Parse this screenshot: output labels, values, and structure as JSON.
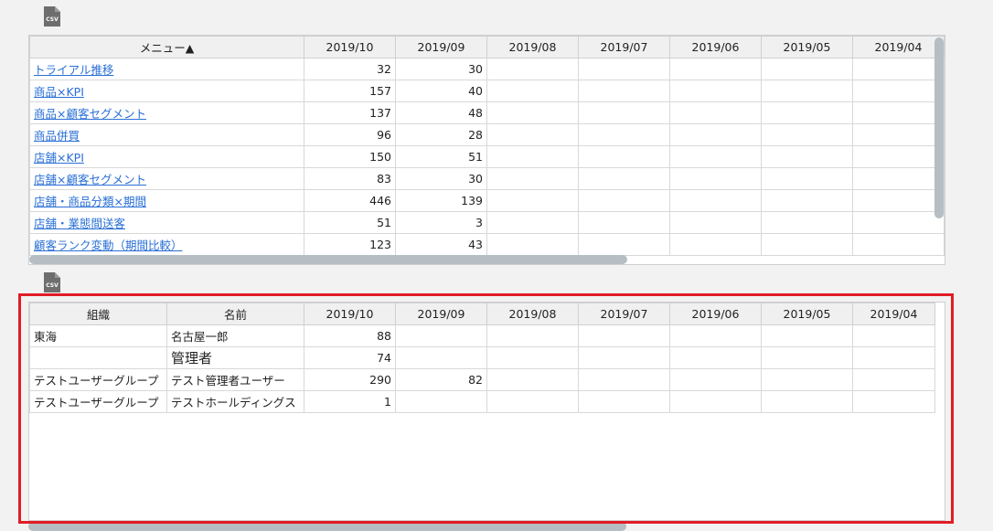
{
  "csv_icon_label": "CSV",
  "menu_table": {
    "columns": [
      "メニュー▲",
      "2019/10",
      "2019/09",
      "2019/08",
      "2019/07",
      "2019/06",
      "2019/05",
      "2019/04"
    ],
    "rows": [
      {
        "name": "トライアル推移",
        "v1": "32",
        "v2": "30"
      },
      {
        "name": "商品×KPI",
        "v1": "157",
        "v2": "40"
      },
      {
        "name": "商品×顧客セグメント",
        "v1": "137",
        "v2": "48"
      },
      {
        "name": "商品併買",
        "v1": "96",
        "v2": "28"
      },
      {
        "name": "店舗×KPI",
        "v1": "150",
        "v2": "51"
      },
      {
        "name": "店舗×顧客セグメント",
        "v1": "83",
        "v2": "30"
      },
      {
        "name": "店舗・商品分類×期間",
        "v1": "446",
        "v2": "139"
      },
      {
        "name": "店舗・業態間送客",
        "v1": "51",
        "v2": "3"
      },
      {
        "name": "顧客ランク変動（期間比較）",
        "v1": "123",
        "v2": "43"
      }
    ]
  },
  "user_table": {
    "columns": [
      "組織",
      "名前",
      "2019/10",
      "2019/09",
      "2019/08",
      "2019/07",
      "2019/06",
      "2019/05",
      "2019/04"
    ],
    "rows": [
      {
        "org": "東海",
        "name": "名古屋一郎",
        "v1": "88",
        "v2": ""
      },
      {
        "org": "",
        "name": "管理者",
        "v1": "74",
        "v2": ""
      },
      {
        "org": "テストユーザーグループ",
        "name": "テスト管理者ユーザー",
        "v1": "290",
        "v2": "82"
      },
      {
        "org": "テストユーザーグループ",
        "name": "テストホールディングス",
        "v1": "1",
        "v2": ""
      }
    ]
  },
  "highlight_color": "#e11d26"
}
